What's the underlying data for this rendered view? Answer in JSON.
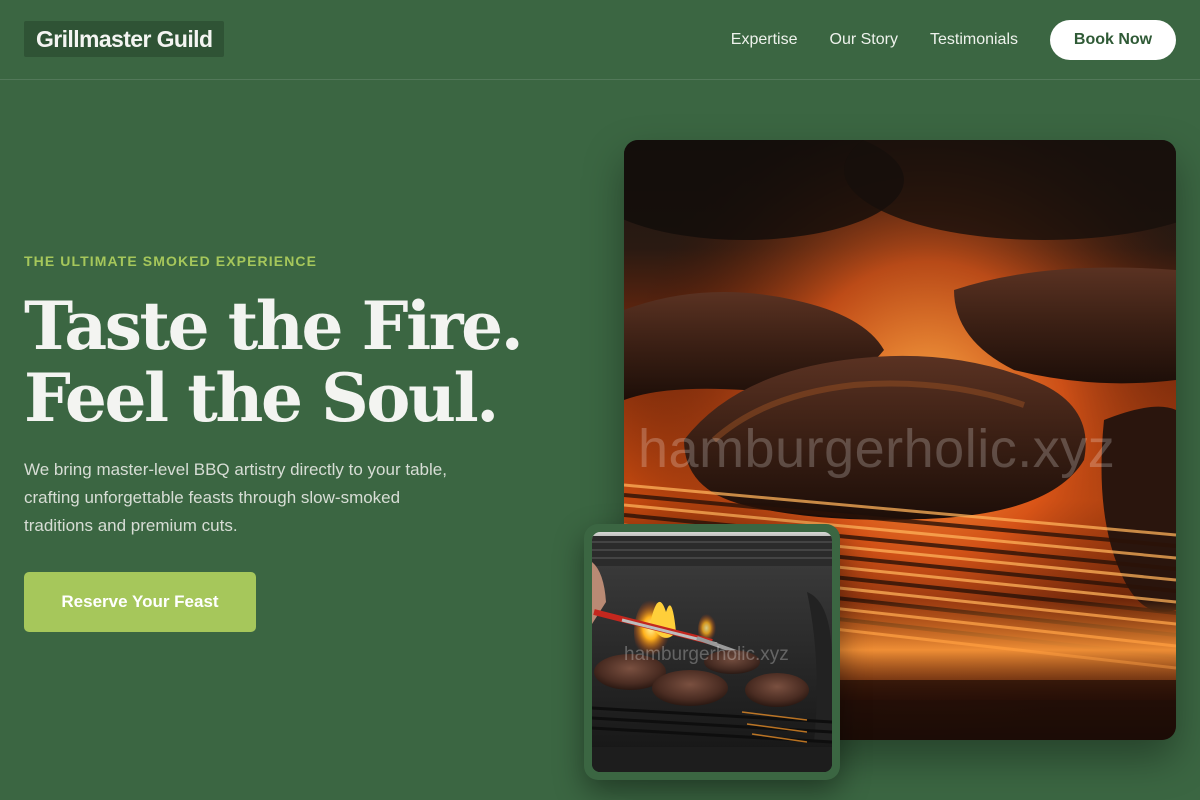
{
  "header": {
    "brand": "Grillmaster Guild",
    "nav": [
      "Expertise",
      "Our Story",
      "Testimonials"
    ],
    "book_label": "Book Now"
  },
  "hero": {
    "eyebrow": "THE ULTIMATE SMOKED EXPERIENCE",
    "headline_line1": "Taste the Fire.",
    "headline_line2": "Feel the Soul.",
    "description": "We bring master-level BBQ artistry directly to your table, crafting unforgettable feasts through slow-smoked traditions and premium cuts.",
    "cta_label": "Reserve Your Feast"
  },
  "images": {
    "main_watermark": "hamburgerholic.xyz",
    "inset_watermark": "hamburgerholic.xyz"
  },
  "colors": {
    "background": "#3b6642",
    "brand_badge": "#2f5335",
    "accent": "#a6c75b",
    "button_text": "#2f5a36"
  }
}
